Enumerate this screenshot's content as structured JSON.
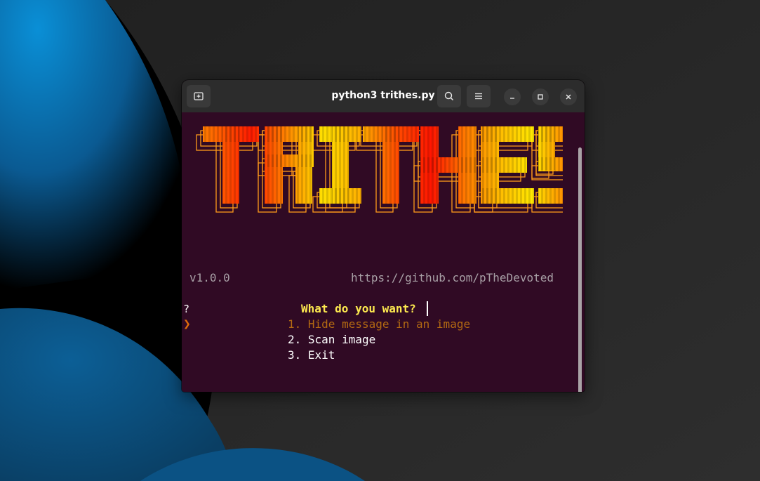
{
  "window": {
    "title": "python3 trithes.py",
    "icons": {
      "new_tab": "new-tab-icon",
      "search": "search-icon",
      "menu": "hamburger-menu-icon",
      "minimize": "minimize-icon",
      "maximize": "maximize-icon",
      "close": "close-icon"
    }
  },
  "terminal": {
    "banner_text": "TRITHES",
    "version": "v1.0.0",
    "url": "https://github.com/pTheDevoted",
    "question_mark": "?",
    "prompt": "What do you want?",
    "pointer": "❯",
    "options": [
      "1. Hide message in an image",
      "2. Scan image",
      "3. Exit"
    ],
    "selected_index": 0
  },
  "colors": {
    "terminal_bg": "#300a24",
    "titlebar_bg": "#2c2c2c",
    "prompt": "#fce94f",
    "selected_option": "#b36a12",
    "pointer": "#e06c0a",
    "muted_text": "#a8a0a6",
    "banner_gradient": [
      "#ff8c00",
      "#ff1a00",
      "#ffd700",
      "#ff5a00",
      "#ff1a00",
      "#ff7a00",
      "#ffd700"
    ]
  }
}
